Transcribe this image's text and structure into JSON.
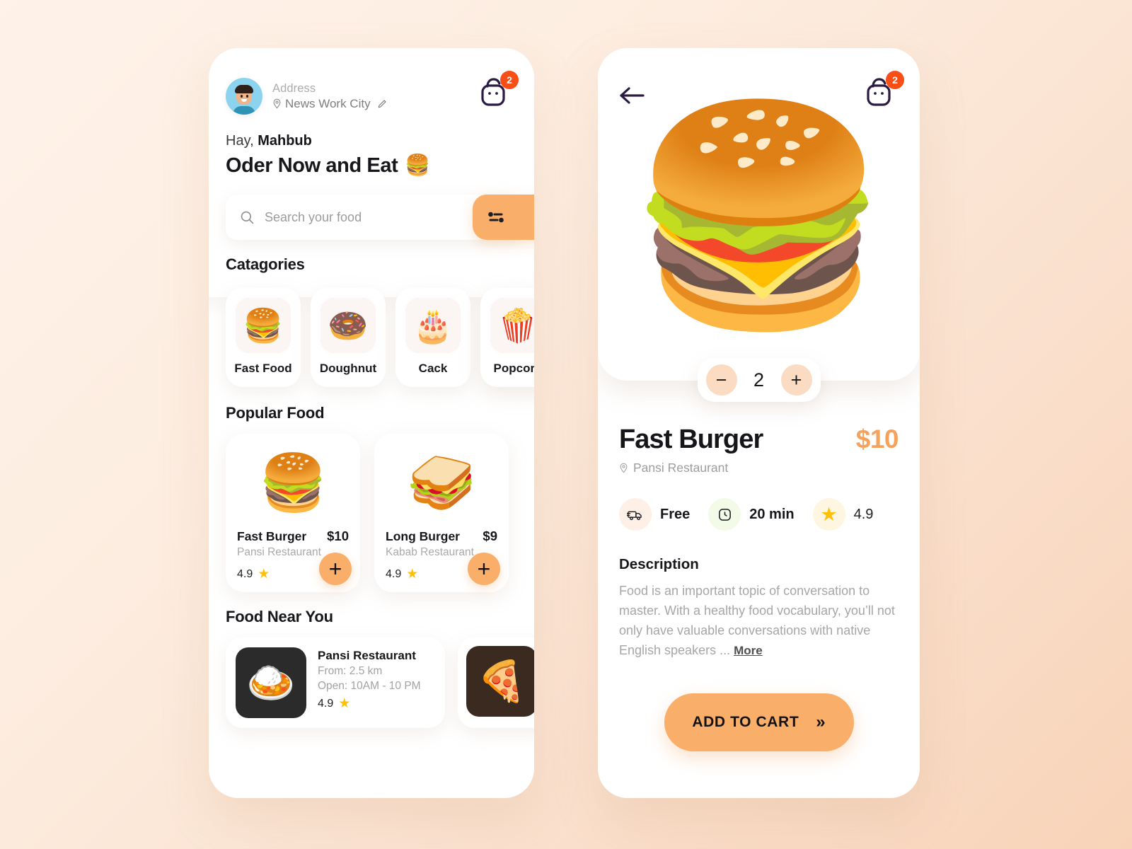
{
  "app": {
    "accent": "#F9AE69",
    "price_accent": "#F5A25D",
    "badge_color": "#F94E16",
    "star_color": "#FFC107"
  },
  "home": {
    "address": {
      "label": "Address",
      "value": "News Work City",
      "pin_icon": "location-pin-icon",
      "edit_icon": "pencil-edit-icon"
    },
    "cart": {
      "badge": "2",
      "icon": "shopping-bag-icon"
    },
    "greeting_prefix": "Hay,",
    "greeting_name": "Mahbub",
    "headline": "Oder Now and Eat",
    "headline_emoji": "🍔",
    "search": {
      "placeholder": "Search your food",
      "value": "",
      "icon": "search-icon",
      "filter_icon": "filter-tune-icon"
    },
    "categories_title": "Catagories",
    "categories": [
      {
        "label": "Fast Food",
        "emoji": "🍔",
        "icon": "burger-icon"
      },
      {
        "label": "Doughnut",
        "emoji": "🍩",
        "icon": "doughnut-icon"
      },
      {
        "label": "Cack",
        "emoji": "🎂",
        "icon": "cake-icon"
      },
      {
        "label": "Popcorn",
        "emoji": "🍿",
        "icon": "popcorn-icon"
      }
    ],
    "popular_title": "Popular Food",
    "popular": [
      {
        "name": "Fast Burger",
        "price": "$10",
        "restaurant": "Pansi Restaurant",
        "rating": "4.9",
        "emoji": "🍔",
        "add_label": "+"
      },
      {
        "name": "Long Burger",
        "price": "$9",
        "restaurant": "Kabab Restaurant",
        "rating": "4.9",
        "emoji": "🥪",
        "add_label": "+"
      }
    ],
    "near_title": "Food Near You",
    "near": [
      {
        "name": "Pansi Restaurant",
        "distance": "From: 2.5 km",
        "hours": "Open: 10AM - 10 PM",
        "rating": "4.9",
        "emoji": "🍛"
      },
      {
        "name": "",
        "emoji": "🍕"
      }
    ]
  },
  "detail": {
    "back_icon": "back-arrow-icon",
    "cart": {
      "badge": "2",
      "icon": "shopping-bag-icon"
    },
    "hero_emoji": "🍔",
    "quantity": {
      "value": "2",
      "minus_label": "−",
      "plus_label": "+"
    },
    "title": "Fast Burger",
    "price": "$10",
    "restaurant": "Pansi Restaurant",
    "stats": [
      {
        "label": "Free",
        "icon": "delivery-truck-icon"
      },
      {
        "label": "20 min",
        "icon": "clock-icon"
      },
      {
        "label": "4.9",
        "icon": "star-icon"
      }
    ],
    "description_title": "Description",
    "description_text": "Food is an important topic of conversation to master. With a healthy food vocabulary, you’ll not only have valuable conversations with native English speakers ...",
    "more_label": "More",
    "cta_label": "ADD TO CART",
    "cta_chevron": "»"
  }
}
